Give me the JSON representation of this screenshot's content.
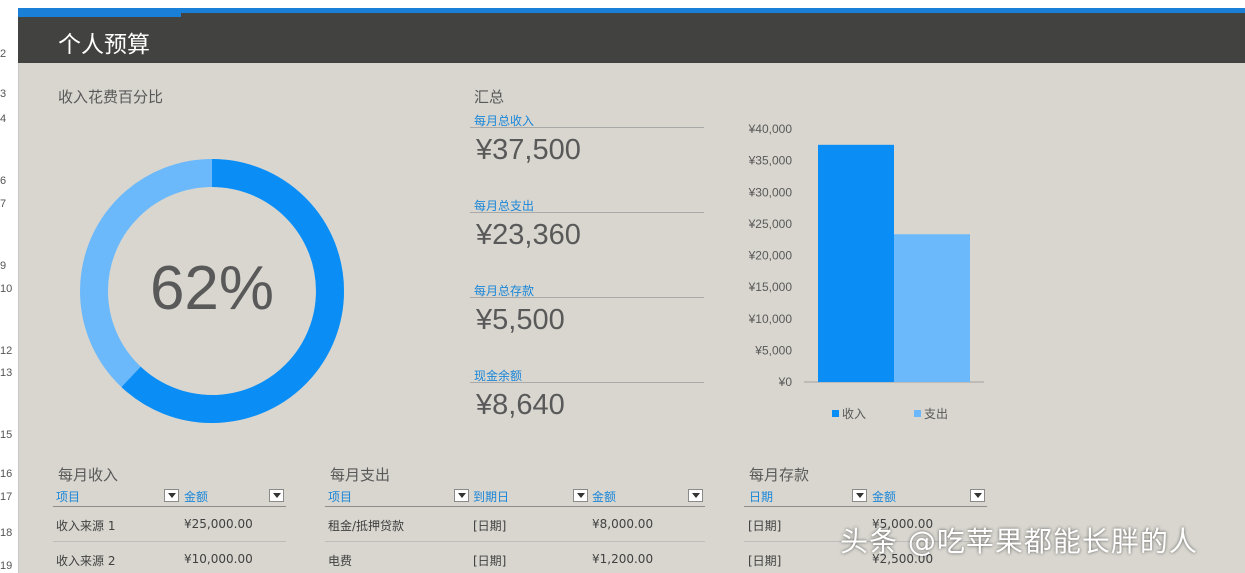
{
  "row_numbers": [
    "2",
    "3",
    "4",
    "6",
    "7",
    "9",
    "10",
    "12",
    "13",
    "15",
    "16",
    "17",
    "18",
    "19"
  ],
  "title": "个人预算",
  "percent_section": {
    "heading": "收入花费百分比",
    "value_label": "62%",
    "spent_fraction": 0.62
  },
  "summary": {
    "heading": "汇总",
    "items": [
      {
        "label": "每月总收入",
        "value": "¥37,500"
      },
      {
        "label": "每月总支出",
        "value": "¥23,360"
      },
      {
        "label": "每月总存款",
        "value": "¥5,500"
      },
      {
        "label": "现金余额",
        "value": "¥8,640"
      }
    ]
  },
  "chart_data": {
    "type": "bar",
    "categories": [
      ""
    ],
    "series": [
      {
        "name": "收入",
        "values": [
          37500
        ],
        "color": "#0a8ef5"
      },
      {
        "name": "支出",
        "values": [
          23360
        ],
        "color": "#6bb9fb"
      }
    ],
    "ylim": [
      0,
      40000
    ],
    "yticks": [
      "¥0",
      "¥5,000",
      "¥10,000",
      "¥15,000",
      "¥20,000",
      "¥25,000",
      "¥30,000",
      "¥35,000",
      "¥40,000"
    ],
    "legend": "bottom",
    "grid": false
  },
  "colors": {
    "ring_primary": "#0a8ef5",
    "ring_secondary": "#6bb9fb",
    "accent": "#1a7fd6",
    "header_bg": "#424240"
  },
  "income": {
    "heading": "每月收入",
    "columns": [
      "项目",
      "金额"
    ],
    "rows": [
      [
        "收入来源 1",
        "¥25,000.00"
      ],
      [
        "收入来源 2",
        "¥10,000.00"
      ]
    ]
  },
  "expense": {
    "heading": "每月支出",
    "columns": [
      "项目",
      "到期日",
      "金额"
    ],
    "rows": [
      [
        "租金/抵押贷款",
        "[日期]",
        "¥8,000.00"
      ],
      [
        "电费",
        "[日期]",
        "¥1,200.00"
      ]
    ]
  },
  "savings": {
    "heading": "每月存款",
    "columns": [
      "日期",
      "金额"
    ],
    "rows": [
      [
        "[日期]",
        "¥5,000.00"
      ],
      [
        "[日期]",
        "¥2,500.00"
      ]
    ]
  },
  "watermark": "头条 @吃苹果都能长胖的人"
}
